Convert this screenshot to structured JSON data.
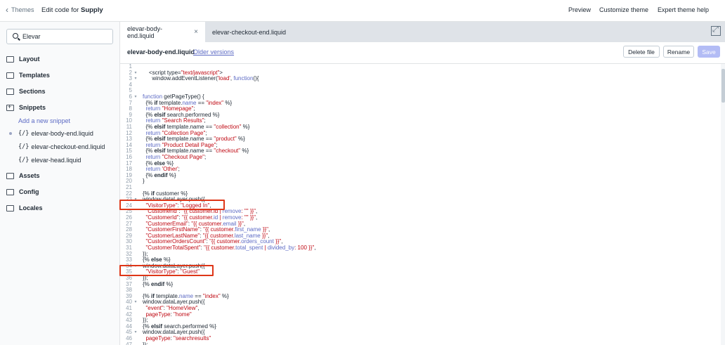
{
  "topbar": {
    "back_label": "Themes",
    "title_prefix": "Edit code for ",
    "title_store": "Supply",
    "links": [
      "Preview",
      "Customize theme",
      "Expert theme help"
    ]
  },
  "sidebar": {
    "search_value": "Elevar",
    "folders": [
      "Layout",
      "Templates",
      "Sections",
      "Snippets",
      "Assets",
      "Config",
      "Locales"
    ],
    "add_snippet": "Add a new snippet",
    "snippets": [
      "elevar-body-end.liquid",
      "elevar-checkout-end.liquid",
      "elevar-head.liquid"
    ]
  },
  "tabs": [
    {
      "label": "elevar-body-end.liquid",
      "close": "×"
    },
    {
      "label": "elevar-checkout-end.liquid"
    }
  ],
  "filebar": {
    "filename": "elevar-body-end.liquid",
    "older_versions": "Older versions",
    "delete_label": "Delete file",
    "rename_label": "Rename",
    "save_label": "Save"
  },
  "code_lines": [
    {
      "n": "1",
      "fold": "",
      "segs": [
        {
          "t": ""
        }
      ]
    },
    {
      "n": "2",
      "fold": "▾",
      "segs": [
        {
          "t": "    <script type=",
          "c": "src"
        },
        {
          "t": "\"text/javascript\"",
          "c": "s"
        },
        {
          "t": ">",
          "c": "src"
        }
      ]
    },
    {
      "n": "3",
      "fold": "▾",
      "segs": [
        {
          "t": "      window.addEventListener(",
          "c": "src"
        },
        {
          "t": "'load'",
          "c": "s"
        },
        {
          "t": ", ",
          "c": "src"
        },
        {
          "t": "function",
          "c": "k"
        },
        {
          "t": "(){",
          "c": "src"
        }
      ]
    },
    {
      "n": "4",
      "fold": "",
      "segs": [
        {
          "t": ""
        }
      ]
    },
    {
      "n": "5",
      "fold": "",
      "segs": [
        {
          "t": ""
        }
      ]
    },
    {
      "n": "6",
      "fold": "▾",
      "segs": [
        {
          "t": "function",
          "c": "k"
        },
        {
          "t": " getPageType() {",
          "c": "src"
        }
      ]
    },
    {
      "n": "7",
      "fold": "",
      "segs": [
        {
          "t": "  {% ",
          "c": "src"
        },
        {
          "t": "if",
          "c": "kb"
        },
        {
          "t": " template.",
          "c": "src"
        },
        {
          "t": "name",
          "c": "k"
        },
        {
          "t": " == ",
          "c": "src"
        },
        {
          "t": "\"index\"",
          "c": "s"
        },
        {
          "t": " %}",
          "c": "src"
        }
      ]
    },
    {
      "n": "8",
      "fold": "",
      "segs": [
        {
          "t": "  return ",
          "c": "k"
        },
        {
          "t": "\"Homepage\"",
          "c": "s"
        },
        {
          "t": ";",
          "c": "src"
        }
      ]
    },
    {
      "n": "9",
      "fold": "",
      "segs": [
        {
          "t": "  {% ",
          "c": "src"
        },
        {
          "t": "elsif",
          "c": "kb"
        },
        {
          "t": " search.performed %}",
          "c": "src"
        }
      ]
    },
    {
      "n": "10",
      "fold": "",
      "segs": [
        {
          "t": "  return ",
          "c": "k"
        },
        {
          "t": "\"Search Results\"",
          "c": "s"
        },
        {
          "t": ";",
          "c": "src"
        }
      ]
    },
    {
      "n": "11",
      "fold": "",
      "segs": [
        {
          "t": "  {% ",
          "c": "src"
        },
        {
          "t": "elsif",
          "c": "kb"
        },
        {
          "t": " template.name == ",
          "c": "src"
        },
        {
          "t": "\"collection\"",
          "c": "s"
        },
        {
          "t": " %}",
          "c": "src"
        }
      ]
    },
    {
      "n": "12",
      "fold": "",
      "segs": [
        {
          "t": "  return ",
          "c": "k"
        },
        {
          "t": "\"Collection Page\"",
          "c": "s"
        },
        {
          "t": ";",
          "c": "src"
        }
      ]
    },
    {
      "n": "13",
      "fold": "",
      "segs": [
        {
          "t": "  {% ",
          "c": "src"
        },
        {
          "t": "elsif",
          "c": "kb"
        },
        {
          "t": " template.name == ",
          "c": "src"
        },
        {
          "t": "\"product\"",
          "c": "s"
        },
        {
          "t": " %}",
          "c": "src"
        }
      ]
    },
    {
      "n": "14",
      "fold": "",
      "segs": [
        {
          "t": "  return ",
          "c": "k"
        },
        {
          "t": "\"Product Detail Page\"",
          "c": "s"
        },
        {
          "t": ";",
          "c": "src"
        }
      ]
    },
    {
      "n": "15",
      "fold": "",
      "segs": [
        {
          "t": "  {% ",
          "c": "src"
        },
        {
          "t": "elsif",
          "c": "kb"
        },
        {
          "t": " template.name == ",
          "c": "src"
        },
        {
          "t": "\"checkout\"",
          "c": "s"
        },
        {
          "t": " %}",
          "c": "src"
        }
      ]
    },
    {
      "n": "16",
      "fold": "",
      "segs": [
        {
          "t": "  return ",
          "c": "k"
        },
        {
          "t": "\"Checkout Page\"",
          "c": "s"
        },
        {
          "t": ";",
          "c": "src"
        }
      ]
    },
    {
      "n": "17",
      "fold": "",
      "segs": [
        {
          "t": "  {% ",
          "c": "src"
        },
        {
          "t": "else",
          "c": "kb"
        },
        {
          "t": " %}",
          "c": "src"
        }
      ]
    },
    {
      "n": "18",
      "fold": "",
      "segs": [
        {
          "t": "  return ",
          "c": "k"
        },
        {
          "t": "'Other'",
          "c": "s"
        },
        {
          "t": ";",
          "c": "src"
        }
      ]
    },
    {
      "n": "19",
      "fold": "",
      "segs": [
        {
          "t": "  {% ",
          "c": "src"
        },
        {
          "t": "endif",
          "c": "kb"
        },
        {
          "t": " %}",
          "c": "src"
        }
      ]
    },
    {
      "n": "20",
      "fold": "",
      "segs": [
        {
          "t": "}",
          "c": "src"
        }
      ]
    },
    {
      "n": "21",
      "fold": "",
      "segs": [
        {
          "t": ""
        }
      ]
    },
    {
      "n": "22",
      "fold": "",
      "segs": [
        {
          "t": "{% ",
          "c": "src"
        },
        {
          "t": "if",
          "c": "kb"
        },
        {
          "t": " customer %}",
          "c": "src"
        }
      ]
    },
    {
      "n": "23",
      "fold": "▾",
      "segs": [
        {
          "t": "window.dataLayer.push({",
          "c": "src"
        }
      ]
    },
    {
      "n": "24",
      "fold": "",
      "segs": [
        {
          "t": "  ",
          "c": "src"
        },
        {
          "t": "\"VisitorType\"",
          "c": "s"
        },
        {
          "t": ": ",
          "c": "src"
        },
        {
          "t": "\"Logged In\"",
          "c": "s"
        },
        {
          "t": ",",
          "c": "src"
        }
      ]
    },
    {
      "n": "25",
      "fold": "",
      "segs": [
        {
          "t": "  ",
          "c": "src"
        },
        {
          "t": "\"CustomerId\"",
          "c": "s"
        },
        {
          "t": ": ",
          "c": "src"
        },
        {
          "t": "\"{{ customer.id | ",
          "c": "s"
        },
        {
          "t": "remove",
          "c": "k"
        },
        {
          "t": ": \"\" }}\"",
          "c": "s"
        },
        {
          "t": ",",
          "c": "src"
        }
      ]
    },
    {
      "n": "26",
      "fold": "",
      "segs": [
        {
          "t": "  ",
          "c": "src"
        },
        {
          "t": "\"CustomerId\"",
          "c": "s"
        },
        {
          "t": ": ",
          "c": "src"
        },
        {
          "t": "\"{{ customer.",
          "c": "s"
        },
        {
          "t": "id",
          "c": "k"
        },
        {
          "t": " | ",
          "c": "s"
        },
        {
          "t": "remove",
          "c": "k"
        },
        {
          "t": ": \"\" }}\"",
          "c": "s"
        },
        {
          "t": ",",
          "c": "src"
        }
      ]
    },
    {
      "n": "27",
      "fold": "",
      "segs": [
        {
          "t": "  ",
          "c": "src"
        },
        {
          "t": "\"CustomerEmail\"",
          "c": "s"
        },
        {
          "t": ": ",
          "c": "src"
        },
        {
          "t": "\"{{ customer.",
          "c": "s"
        },
        {
          "t": "email",
          "c": "k"
        },
        {
          "t": " }}\"",
          "c": "s"
        },
        {
          "t": ",",
          "c": "src"
        }
      ]
    },
    {
      "n": "28",
      "fold": "",
      "segs": [
        {
          "t": "  ",
          "c": "src"
        },
        {
          "t": "\"CustomerFirstName\"",
          "c": "s"
        },
        {
          "t": ": ",
          "c": "src"
        },
        {
          "t": "\"{{ customer.",
          "c": "s"
        },
        {
          "t": "first_name",
          "c": "k"
        },
        {
          "t": " }}\"",
          "c": "s"
        },
        {
          "t": ",",
          "c": "src"
        }
      ]
    },
    {
      "n": "29",
      "fold": "",
      "segs": [
        {
          "t": "  ",
          "c": "src"
        },
        {
          "t": "\"CustomerLastName\"",
          "c": "s"
        },
        {
          "t": ": ",
          "c": "src"
        },
        {
          "t": "\"{{ customer.",
          "c": "s"
        },
        {
          "t": "last_name",
          "c": "k"
        },
        {
          "t": " }}\"",
          "c": "s"
        },
        {
          "t": ",",
          "c": "src"
        }
      ]
    },
    {
      "n": "30",
      "fold": "",
      "segs": [
        {
          "t": "  ",
          "c": "src"
        },
        {
          "t": "\"CustomerOrdersCount\"",
          "c": "s"
        },
        {
          "t": ": ",
          "c": "src"
        },
        {
          "t": "\"{{ customer.",
          "c": "s"
        },
        {
          "t": "orders_count",
          "c": "k"
        },
        {
          "t": " }}\"",
          "c": "s"
        },
        {
          "t": ",",
          "c": "src"
        }
      ]
    },
    {
      "n": "31",
      "fold": "",
      "segs": [
        {
          "t": "  ",
          "c": "src"
        },
        {
          "t": "\"CustomerTotalSpent\"",
          "c": "s"
        },
        {
          "t": ": ",
          "c": "src"
        },
        {
          "t": "\"{{ customer.",
          "c": "s"
        },
        {
          "t": "total_spent",
          "c": "k"
        },
        {
          "t": " | ",
          "c": "s"
        },
        {
          "t": "divided_by",
          "c": "k"
        },
        {
          "t": ": 100 }}\"",
          "c": "s"
        },
        {
          "t": ",",
          "c": "src"
        }
      ]
    },
    {
      "n": "32",
      "fold": "",
      "segs": [
        {
          "t": "});",
          "c": "src"
        }
      ]
    },
    {
      "n": "33",
      "fold": "",
      "segs": [
        {
          "t": "{% ",
          "c": "src"
        },
        {
          "t": "else",
          "c": "kb"
        },
        {
          "t": " %}",
          "c": "src"
        }
      ]
    },
    {
      "n": "34",
      "fold": "▾",
      "segs": [
        {
          "t": "window.dataLayer.push({",
          "c": "src"
        }
      ]
    },
    {
      "n": "35",
      "fold": "",
      "segs": [
        {
          "t": "  ",
          "c": "src"
        },
        {
          "t": "\"VisitorType\"",
          "c": "s"
        },
        {
          "t": ": ",
          "c": "src"
        },
        {
          "t": "\"Guest\"",
          "c": "s"
        }
      ]
    },
    {
      "n": "36",
      "fold": "",
      "segs": [
        {
          "t": "});",
          "c": "src"
        }
      ]
    },
    {
      "n": "37",
      "fold": "",
      "segs": [
        {
          "t": "{% ",
          "c": "src"
        },
        {
          "t": "endif",
          "c": "kb"
        },
        {
          "t": " %}",
          "c": "src"
        }
      ]
    },
    {
      "n": "38",
      "fold": "",
      "segs": [
        {
          "t": ""
        }
      ]
    },
    {
      "n": "39",
      "fold": "",
      "segs": [
        {
          "t": "{% ",
          "c": "src"
        },
        {
          "t": "if",
          "c": "kb"
        },
        {
          "t": " template.",
          "c": "src"
        },
        {
          "t": "name",
          "c": "k"
        },
        {
          "t": " == ",
          "c": "src"
        },
        {
          "t": "\"index\"",
          "c": "s"
        },
        {
          "t": " %}",
          "c": "src"
        }
      ]
    },
    {
      "n": "40",
      "fold": "▾",
      "segs": [
        {
          "t": "window.dataLayer.push({",
          "c": "src"
        }
      ]
    },
    {
      "n": "41",
      "fold": "",
      "segs": [
        {
          "t": "  ",
          "c": "src"
        },
        {
          "t": "\"event\"",
          "c": "s"
        },
        {
          "t": ": ",
          "c": "src"
        },
        {
          "t": "\"HomeView\"",
          "c": "s"
        },
        {
          "t": ",",
          "c": "src"
        }
      ]
    },
    {
      "n": "42",
      "fold": "",
      "segs": [
        {
          "t": "  pageType",
          "c": "s"
        },
        {
          "t": ": ",
          "c": "src"
        },
        {
          "t": "\"home\"",
          "c": "s"
        }
      ]
    },
    {
      "n": "43",
      "fold": "",
      "segs": [
        {
          "t": "});",
          "c": "src"
        }
      ]
    },
    {
      "n": "44",
      "fold": "",
      "segs": [
        {
          "t": "{% ",
          "c": "src"
        },
        {
          "t": "elsif",
          "c": "kb"
        },
        {
          "t": " search.performed %}",
          "c": "src"
        }
      ]
    },
    {
      "n": "45",
      "fold": "▾",
      "segs": [
        {
          "t": "window.dataLayer.push({",
          "c": "src"
        }
      ]
    },
    {
      "n": "46",
      "fold": "",
      "segs": [
        {
          "t": "  pageType",
          "c": "s"
        },
        {
          "t": ": ",
          "c": "src"
        },
        {
          "t": "\"searchresults\"",
          "c": "s"
        }
      ]
    },
    {
      "n": "47",
      "fold": "",
      "segs": [
        {
          "t": "});",
          "c": "src"
        }
      ]
    }
  ],
  "colors": {
    "highlight_box": "#de3618",
    "string": "#bf0711",
    "keyword": "#5c6ac4",
    "link": "#5c6ac4"
  },
  "icons": [
    "chevron-left-icon",
    "search-icon",
    "folder-icon",
    "code-snippet-icon",
    "close-icon",
    "fullscreen-icon"
  ]
}
